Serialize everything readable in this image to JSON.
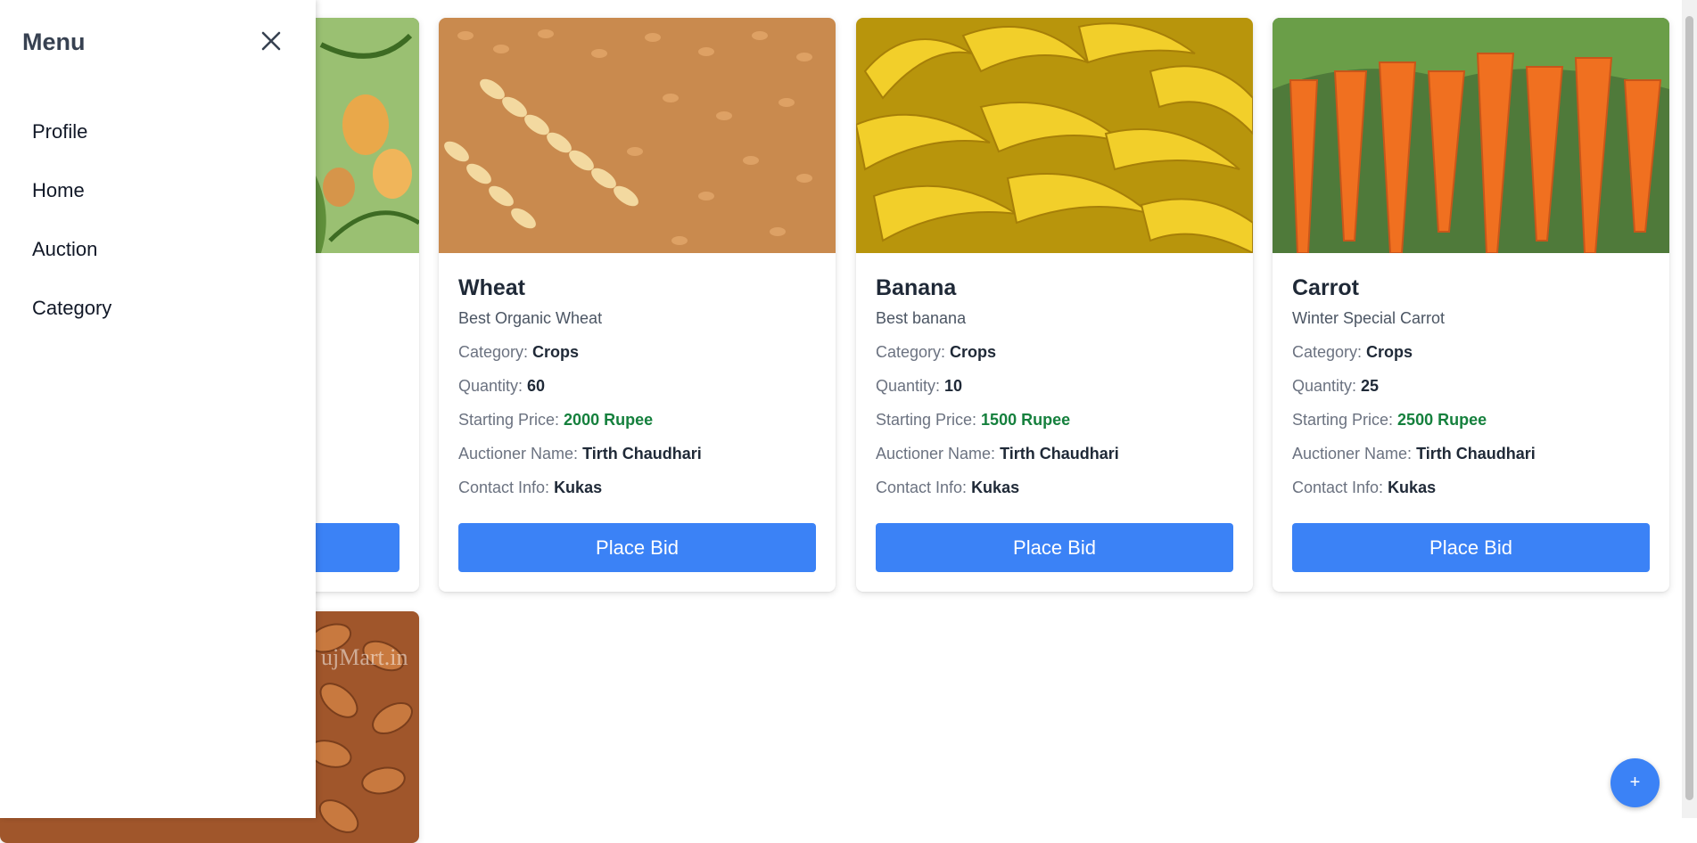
{
  "sidebar": {
    "title": "Menu",
    "items": [
      {
        "label": "Profile"
      },
      {
        "label": "Home"
      },
      {
        "label": "Auction"
      },
      {
        "label": "Category"
      }
    ]
  },
  "labels": {
    "category": "Category: ",
    "quantity": "Quantity: ",
    "starting_price": "Starting Price: ",
    "auctioner_name": "Auctioner Name: ",
    "contact_info": "Contact Info: ",
    "place_bid": "Place Bid"
  },
  "products": [
    {
      "name": "Wheat",
      "description": "Best Organic Wheat",
      "category": "Crops",
      "quantity": "60",
      "starting_price": "2000 Rupee",
      "auctioner_name": "Tirth Chaudhari",
      "contact_info": "Kukas",
      "image": "wheat-image"
    },
    {
      "name": "Banana",
      "description": "Best banana",
      "category": "Crops",
      "quantity": "10",
      "starting_price": "1500 Rupee",
      "auctioner_name": "Tirth Chaudhari",
      "contact_info": "Kukas",
      "image": "banana-image"
    },
    {
      "name": "Carrot",
      "description": "Winter Special Carrot",
      "category": "Crops",
      "quantity": "25",
      "starting_price": "2500 Rupee",
      "auctioner_name": "Tirth Chaudhari",
      "contact_info": "Kukas",
      "image": "carrot-image"
    }
  ],
  "partial_cards": [
    {
      "image": "mango-image",
      "button": "place-bid"
    },
    {
      "image": "almond-image",
      "watermark": "ujMart.in"
    }
  ],
  "fab": {
    "label": "+"
  },
  "colors": {
    "accent": "#3b82f6",
    "price": "#15803d"
  }
}
